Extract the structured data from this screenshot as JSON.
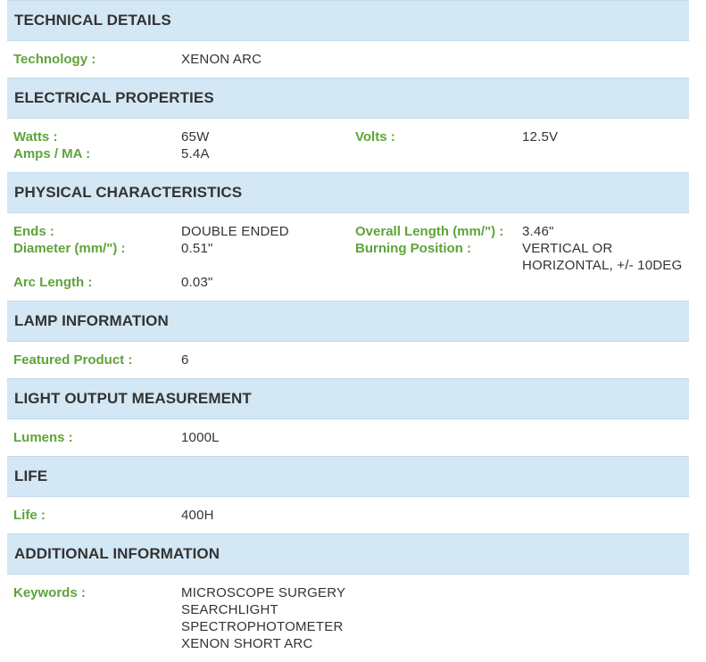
{
  "sections": [
    {
      "title": "TECHNICAL DETAILS",
      "rows": [
        {
          "label": "Technology :",
          "value": "XENON ARC"
        }
      ]
    },
    {
      "title": "ELECTRICAL PROPERTIES",
      "rows": [
        {
          "label": "Watts :",
          "value": "65W",
          "label2": "Volts :",
          "value2": "12.5V"
        },
        {
          "label": "Amps / MA :",
          "value": "5.4A"
        }
      ]
    },
    {
      "title": "PHYSICAL CHARACTERISTICS",
      "rows": [
        {
          "label": "Ends :",
          "value": "DOUBLE ENDED",
          "label2": "Overall Length (mm/\") :",
          "value2": "3.46\""
        },
        {
          "label": "Diameter (mm/\") :",
          "value": "0.51\"",
          "label2": "Burning Position :",
          "value2_lines": [
            "VERTICAL OR",
            "HORIZONTAL, +/- 10DEG"
          ]
        },
        {
          "label": "Arc Length :",
          "value": "0.03\""
        }
      ]
    },
    {
      "title": "LAMP INFORMATION",
      "rows": [
        {
          "label": "Featured Product :",
          "value": "6"
        }
      ]
    },
    {
      "title": "LIGHT OUTPUT MEASUREMENT",
      "rows": [
        {
          "label": "Lumens :",
          "value": "1000L"
        }
      ]
    },
    {
      "title": "LIFE",
      "rows": [
        {
          "label": "Life :",
          "value": "400H"
        }
      ]
    },
    {
      "title": "ADDITIONAL INFORMATION",
      "rows": [
        {
          "label": "Keywords :",
          "value_lines": [
            "MICROSCOPE SURGERY",
            "SEARCHLIGHT",
            "SPECTROPHOTOMETER",
            "XENON SHORT ARC"
          ]
        }
      ]
    }
  ]
}
